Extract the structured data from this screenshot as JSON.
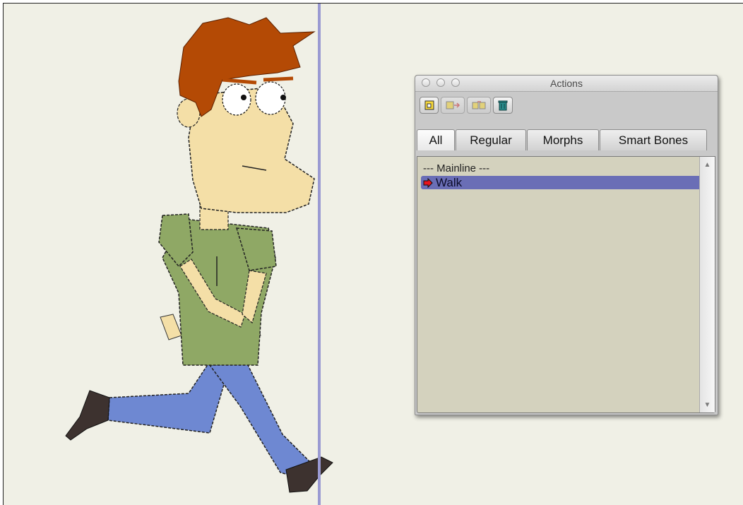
{
  "window": {
    "title": "Actions"
  },
  "toolbar": {
    "buttons": [
      {
        "name": "new-action-icon",
        "enabled": true
      },
      {
        "name": "insert-action-icon",
        "enabled": false
      },
      {
        "name": "copy-action-icon",
        "enabled": false
      },
      {
        "name": "trash-icon",
        "enabled": true
      }
    ]
  },
  "tabs": [
    {
      "label": "All",
      "active": true
    },
    {
      "label": "Regular",
      "active": false
    },
    {
      "label": "Morphs",
      "active": false
    },
    {
      "label": "Smart Bones",
      "active": false
    }
  ],
  "list": {
    "header": "--- Mainline ---",
    "items": [
      {
        "label": "Walk",
        "selected": true,
        "icon": "red-arrow-icon"
      }
    ]
  },
  "colors": {
    "canvas_bg": "#f0f0e6",
    "marker": "#9a9ad2",
    "selection": "#6a6eb6",
    "list_bg": "#d4d2be"
  }
}
